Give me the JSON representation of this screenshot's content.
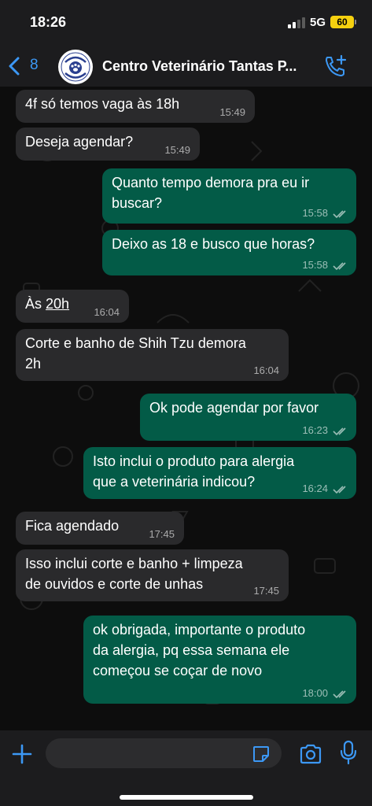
{
  "status_bar": {
    "time": "18:26",
    "network": "5G",
    "battery": "60"
  },
  "header": {
    "back_count": "8",
    "contact_name": "Centro Veterinário Tantas P...",
    "avatar_text": "tantas patas"
  },
  "messages": [
    {
      "dir": "in",
      "text": "4f só temos vaga às 18h",
      "time": "15:49"
    },
    {
      "dir": "in",
      "text": "Deseja agendar?",
      "time": "15:49"
    },
    {
      "dir": "out",
      "lines": [
        "Quanto tempo demora pra eu ir",
        "buscar?"
      ],
      "time": "15:58"
    },
    {
      "dir": "out",
      "text": "Deixo as 18 e busco que horas?",
      "time": "15:58"
    },
    {
      "dir": "in",
      "prefix": "Às ",
      "underlined": "20h",
      "time": "16:04"
    },
    {
      "dir": "in",
      "lines": [
        "Corte e banho de Shih Tzu demora",
        "2h"
      ],
      "time": "16:04"
    },
    {
      "dir": "out",
      "text": "Ok pode agendar por favor",
      "time": "16:23"
    },
    {
      "dir": "out",
      "lines": [
        "Isto inclui o produto para alergia",
        "que a veterinária indicou?"
      ],
      "time": "16:24"
    },
    {
      "dir": "in",
      "text": "Fica agendado",
      "time": "17:45"
    },
    {
      "dir": "in",
      "lines": [
        "Isso inclui corte e banho + limpeza",
        "de ouvidos e corte de unhas"
      ],
      "time": "17:45"
    },
    {
      "dir": "out",
      "lines": [
        "ok obrigada, importante o produto",
        "da alergia, pq essa semana ele",
        "começou se coçar de novo"
      ],
      "time": "18:00"
    }
  ],
  "input": {
    "value": "",
    "placeholder": ""
  },
  "colors": {
    "accent": "#3c98f5",
    "incoming_bubble": "#2a2a2c",
    "outgoing_bubble": "#035b47",
    "battery": "#f6d10f"
  },
  "icons": {
    "back": "chevron-left-icon",
    "call": "add-call-icon",
    "plus": "plus-icon",
    "sticker": "sticker-icon",
    "camera": "camera-icon",
    "mic": "microphone-icon",
    "read": "double-check-icon"
  }
}
